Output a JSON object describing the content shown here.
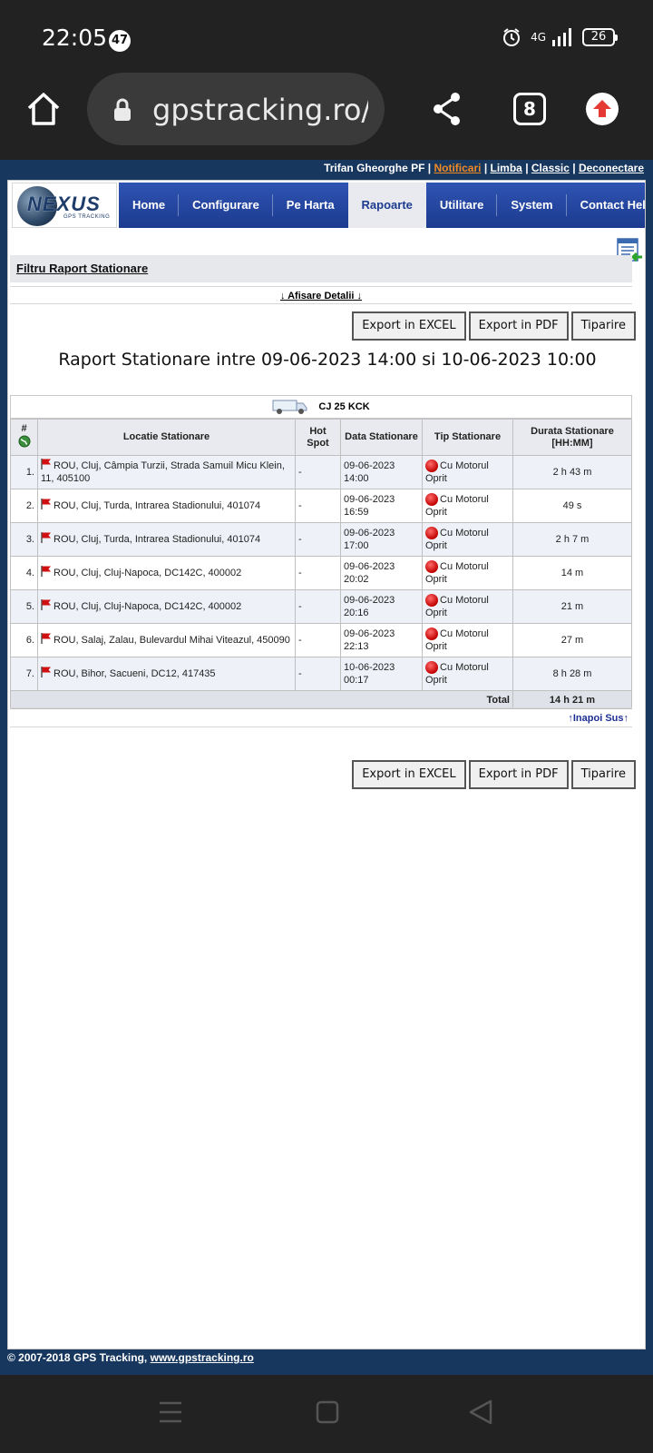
{
  "status_bar": {
    "time": "22:05",
    "notification_count": "47",
    "network": "4G",
    "battery": "26"
  },
  "browser": {
    "url": "gpstracking.ro/rc",
    "tab_count": "8"
  },
  "user_links": {
    "user": "Trifan Gheorghe PF",
    "notificari": "Notificari",
    "limba": "Limba",
    "classic": "Classic",
    "deconectare": "Deconectare"
  },
  "logo": {
    "text": "NEXUS",
    "subtitle": "GPS TRACKING"
  },
  "nav": [
    "Home",
    "Configurare",
    "Pe Harta",
    "Rapoarte",
    "Utilitare",
    "System",
    "Contact Helpdesk"
  ],
  "filter": {
    "title": "Filtru Raport Stationare",
    "details": "↓ Afisare Detalii ↓"
  },
  "buttons": {
    "excel": "Export in EXCEL",
    "pdf": "Export in PDF",
    "print": "Tiparire"
  },
  "report": {
    "title": "Raport Stationare intre 09-06-2023 14:00 si 10-06-2023 10:00",
    "vehicle": "CJ 25 KCK",
    "headers": {
      "num": "#",
      "locatie": "Locatie Stationare",
      "hot_spot_1": "Hot",
      "hot_spot_2": "Spot",
      "data": "Data Stationare",
      "tip": "Tip Stationare",
      "durata_1": "Durata Stationare",
      "durata_2": "[HH:MM]"
    },
    "rows": [
      {
        "num": "1.",
        "loc": "ROU, Cluj, Câmpia Turzii, Strada Samuil Micu Klein, 11, 405100",
        "hot": "-",
        "date": "09-06-2023",
        "time": "14:00",
        "tip1": "Cu Motorul",
        "tip2": "Oprit",
        "dur": "2 h 43 m"
      },
      {
        "num": "2.",
        "loc": "ROU, Cluj, Turda, Intrarea Stadionului, 401074",
        "hot": "-",
        "date": "09-06-2023",
        "time": "16:59",
        "tip1": "Cu Motorul",
        "tip2": "Oprit",
        "dur": "49 s"
      },
      {
        "num": "3.",
        "loc": "ROU, Cluj, Turda, Intrarea Stadionului, 401074",
        "hot": "-",
        "date": "09-06-2023",
        "time": "17:00",
        "tip1": "Cu Motorul",
        "tip2": "Oprit",
        "dur": "2 h 7 m"
      },
      {
        "num": "4.",
        "loc": "ROU, Cluj, Cluj-Napoca, DC142C, 400002",
        "hot": "-",
        "date": "09-06-2023",
        "time": "20:02",
        "tip1": "Cu Motorul",
        "tip2": "Oprit",
        "dur": "14 m"
      },
      {
        "num": "5.",
        "loc": "ROU, Cluj, Cluj-Napoca, DC142C, 400002",
        "hot": "-",
        "date": "09-06-2023",
        "time": "20:16",
        "tip1": "Cu Motorul",
        "tip2": "Oprit",
        "dur": "21 m"
      },
      {
        "num": "6.",
        "loc": "ROU, Salaj, Zalau, Bulevardul Mihai Viteazul, 450090",
        "hot": "-",
        "date": "09-06-2023",
        "time": "22:13",
        "tip1": "Cu Motorul",
        "tip2": "Oprit",
        "dur": "27 m"
      },
      {
        "num": "7.",
        "loc": "ROU, Bihor, Sacueni, DC12, 417435",
        "hot": "-",
        "date": "10-06-2023",
        "time": "00:17",
        "tip1": "Cu Motorul",
        "tip2": "Oprit",
        "dur": "8 h 28 m"
      }
    ],
    "total_label": "Total",
    "total_value": "14 h 21 m",
    "back_top": "↑Inapoi Sus↑"
  },
  "footer": {
    "copyright": "© 2007-2018 GPS Tracking,",
    "link": "www.gpstracking.ro"
  },
  "colors": {
    "nav_blue": "#2f54b3",
    "page_bg": "#17375e",
    "notif_link": "#f08a24"
  }
}
